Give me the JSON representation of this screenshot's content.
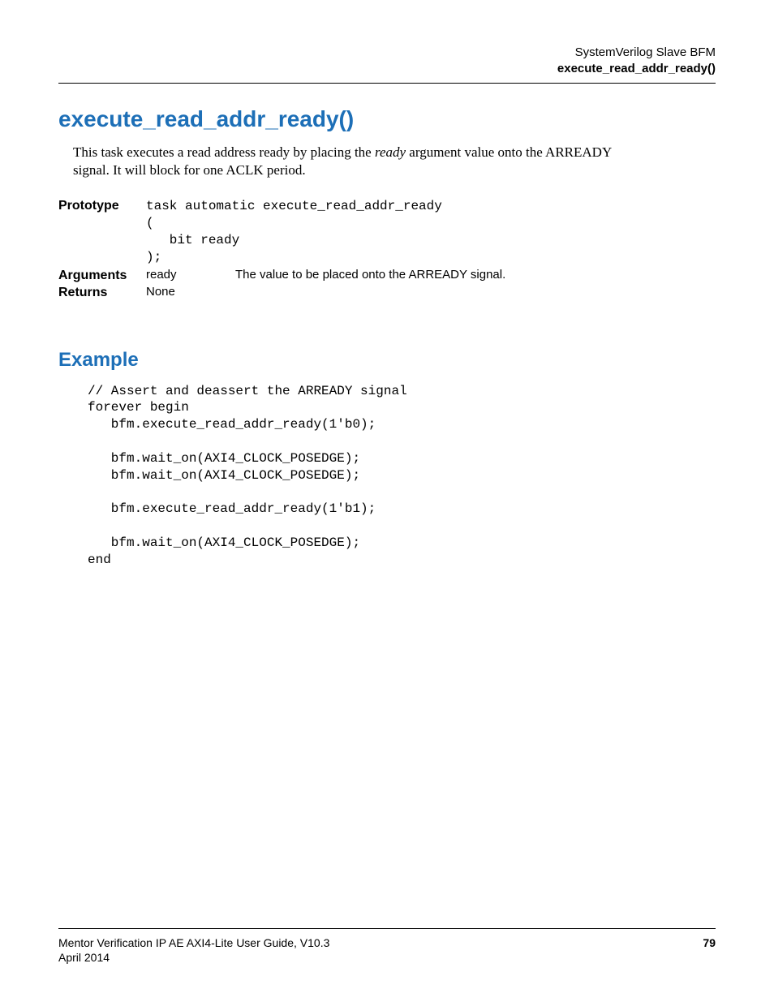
{
  "header": {
    "section": "SystemVerilog Slave BFM",
    "topic": "execute_read_addr_ready()"
  },
  "title": "execute_read_addr_ready()",
  "intro_pre": "This task executes a read address ready by placing the ",
  "intro_em": "ready",
  "intro_post": " argument value onto the ARREADY signal. It will block for one ACLK period.",
  "defs": {
    "prototype_label": "Prototype",
    "prototype_code": "task automatic execute_read_addr_ready\n(\n   bit ready\n);",
    "arguments_label": "Arguments",
    "arg_name": "ready",
    "arg_desc": "The value to be placed onto the ARREADY signal.",
    "returns_label": "Returns",
    "returns_value": "None"
  },
  "example": {
    "heading": "Example",
    "code": "// Assert and deassert the ARREADY signal\nforever begin\n   bfm.execute_read_addr_ready(1'b0);\n\n   bfm.wait_on(AXI4_CLOCK_POSEDGE);\n   bfm.wait_on(AXI4_CLOCK_POSEDGE);\n\n   bfm.execute_read_addr_ready(1'b1);\n\n   bfm.wait_on(AXI4_CLOCK_POSEDGE);\nend"
  },
  "footer": {
    "guide": "Mentor Verification IP AE AXI4-Lite User Guide, V10.3",
    "date": "April 2014",
    "page": "79"
  }
}
